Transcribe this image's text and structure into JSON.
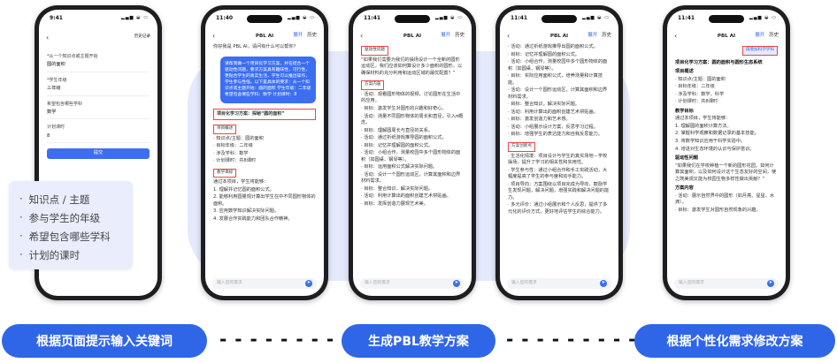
{
  "phone1": {
    "time": "9:41",
    "history": "历史记录",
    "fields": [
      {
        "label": "*从一个知识点或主题开始",
        "value": "圆的面积"
      },
      {
        "label": "*学生年级",
        "value": "三年级"
      },
      {
        "label": "希望包含哪些学科",
        "value": "数学"
      },
      {
        "label": "计划课时",
        "value": "8"
      }
    ],
    "submit": "提交"
  },
  "phone2": {
    "time": "11:40",
    "title": "PBL AI",
    "expand": "展开",
    "history": "历史",
    "greeting": "你好我是 PBL AI，请问有什么可以帮你？",
    "request": "请帮我做一个项目化学习方案，并在结合一个驱动性问题，要求方案具有趣味性，可行性，更贴合学生的真实生活，学生可以推出操作，学生参与性强。以下是具体的要求：从一个知识点或主题开始：圆的面积 学生年级：二年级 希望包含哪些学科：数学 计划课时：8",
    "plan_title": "项目化学习方案：探秘“圆的面积”",
    "box1": "项目概述",
    "overview": [
      "· 知识点/主题：圆的面积",
      "· 目标年级：二年级",
      "· 涉及学科：数学",
      "· 计划课时：共8课时"
    ],
    "box2": "教学目标",
    "goals_intro": "通过本项目，学生将能够：",
    "goals": [
      "1. 理解并记忆圆的面积公式。",
      "2. 能够利用圆量规计算出学生在中不同圆形物体的面积。",
      "3. 应用数学知识解决实际问题。",
      "4. 发展合作实践能力和团队合作精神。"
    ],
    "input_placeholder": "输入您的需求"
  },
  "phone3": {
    "time": "11:41",
    "box1": "驱动性问题",
    "question": "“如果我们需要为我们的操场设计一个全新的圆形运动区，我们应该如何算设计多少面积的圆形，以确保材料的充分利用和运动区域的最优配置？”",
    "box2": "方案内容",
    "items": [
      "· 活动：观看圆形物体的视频，讨论圆形在生活中的应用。",
      "· 目标：激发学生对圆形的兴趣和好奇心。",
      "· 活动：测量不同圆形物体的周长和直径，引入π概念。",
      "· 目标：理解圆周长与直径的关系。",
      "· 活动：通过折纸游戏推导圆的面积公式。",
      "· 目标：记忆并理解圆的面积公式。",
      "· 活动：小组合作，测量校园中多个圆形物体的面积（如圆桌、钢琴等）。",
      "· 目标：运用面积公式解决实际问题。",
      "· 活动：设计一个圆形运动区，计算其面积和边界材料需求。",
      "· 目标：整合知识，解决实际问题。",
      "· 活动：利用计算出的面积创建艺术拼贴画。",
      "· 目标：发挥创造力展现艺术美。"
    ],
    "input_placeholder": "输入您的需求"
  },
  "phone4": {
    "time": "11:41",
    "items": [
      "· 活动：通过折纸游戏推导出圆的面积公式。",
      "· 目标：记忆并理解圆的面积公式。",
      "· 活动：小组合作，测量校园中多个圆形物体的面积（如圆桌、钢琴等）。",
      "· 目标：实际应用面积公式，培养测量和计算技能。",
      "· 活动：设计一个圆形运动区，计算其面积和边界材料需求。",
      "· 目标：整合知识，解决实际问题。",
      "· 活动：利用计算出的面积创建艺术拼贴画。",
      "· 目标：激发创造力和艺术感。",
      "· 活动：小组展示设计方案，反思学习过程。",
      "· 目标：增强学生的表达能力和自我反思能力。"
    ],
    "box": "方案创新点",
    "innovation": [
      "· 生活化情境：项目设计与学生的真实场地－学校操场，提升了学习的相关性和实用性。",
      "· 学生参与性：通过小组合作和手工实践活动，大幅度提高了学生的参与度和动手能力。",
      "· 项目导向：方案围绕以项目完成为导向，鼓励学生发现问题，解决问题，增强实践和解决问题的能力。",
      "· 多元评价：通过小组展示和个人反思，提供了多元化的评价方式，更好地评估学生的综合能力。"
    ],
    "input_placeholder": "输入您的需求"
  },
  "phone5": {
    "time": "11:41",
    "title": "PBL AI",
    "expand": "展开",
    "history": "历史",
    "box": "再增加科学学科",
    "plan_title": "项目化学习方案：圆的面积与圆形生态系统",
    "section1": "项目概述",
    "overview": [
      "· 知识点/主题：圆的面积",
      "· 目标年级：二年级",
      "· 涉及学科：数学，科学",
      "· 计划课时：共8课时"
    ],
    "section2": "教学目标",
    "goals_intro": "通过本项目，学生将能够：",
    "goals": [
      "1. 理解圆的面积计算方法。",
      "2. 掌握科学观察和数据记录的基本技能。",
      "3. 将数学知识应用于科学实验中。",
      "4. 增进对生态环境的认识与保护意识。"
    ],
    "section3": "驱动性问题",
    "question": "“如果我们在学校种植一个新的圆形花园，如何计算其面积，以及如何设计这个生态友好的空间，使之既美观又能为校园生物多样性做出贡献？”",
    "section4": "方案内容",
    "items": [
      "· 活动：展示自然界中的圆形（如月亮、星星、水滴）。",
      "· 目标：激发学生对圆形自然现象的兴趣。"
    ],
    "input_placeholder": "输入您的需求"
  },
  "keywords": [
    "知识点 / 主题",
    "参与学生的年级",
    "希望包含哪些学科",
    "计划的课时"
  ],
  "steps": [
    "根据页面提示输入关键词",
    "生成PBL教学方案",
    "根据个性化需求修改方案"
  ],
  "arrow": "- - - - - - - - ->",
  "accent": "#2f66e8"
}
